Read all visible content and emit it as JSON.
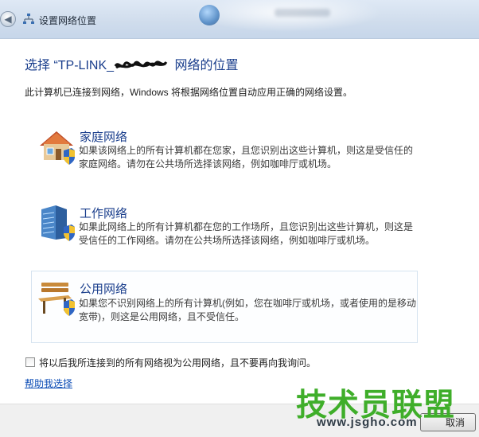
{
  "window": {
    "title": "设置网络位置",
    "back_icon": "back-arrow-icon",
    "title_icon": "network-icon"
  },
  "page": {
    "heading_prefix": "选择 “TP-LINK_",
    "heading_suffix": " 网络的位置",
    "description": "此计算机已连接到网络，Windows 将根据网络位置自动应用正确的网络设置。"
  },
  "options": [
    {
      "title": "家庭网络",
      "description": "如果该网络上的所有计算机都在您家，且您识别出这些计算机，则这是受信任的家庭网络。请勿在公共场所选择该网络，例如咖啡厅或机场。",
      "icon": "house-icon"
    },
    {
      "title": "工作网络",
      "description": "如果此网络上的所有计算机都在您的工作场所，且您识别出这些计算机，则这是受信任的工作网络。请勿在公共场所选择该网络，例如咖啡厅或机场。",
      "icon": "office-building-icon"
    },
    {
      "title": "公用网络",
      "description": "如果您不识别网络上的所有计算机(例如，您在咖啡厅或机场，或者使用的是移动宽带)，则这是公用网络，且不受信任。",
      "icon": "park-bench-icon"
    }
  ],
  "checkbox": {
    "label": "将以后我所连接到的所有网络视为公用网络，且不要再向我询问。",
    "checked": false
  },
  "help_link": "帮助我选择",
  "footer": {
    "cancel_label": "取消"
  },
  "watermark": {
    "text": "技术员联盟",
    "url": "www.jsgho.com"
  },
  "colors": {
    "heading": "#1a3e8c",
    "link": "#0a4bb5",
    "watermark": "#3fae2a"
  }
}
